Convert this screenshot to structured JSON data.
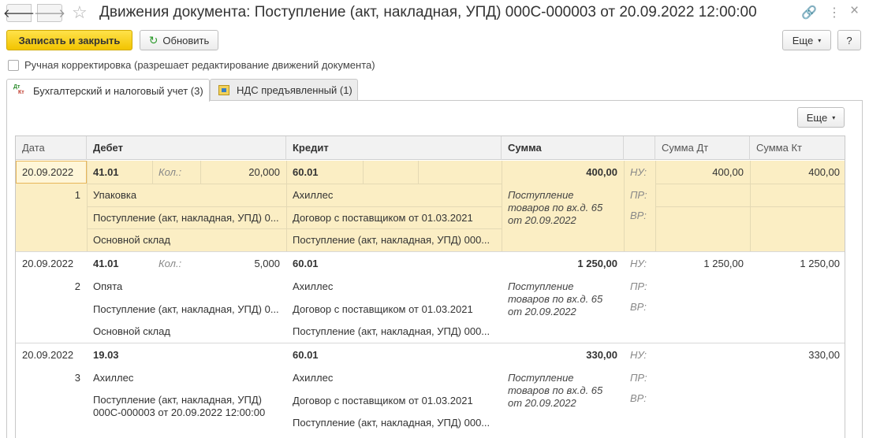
{
  "window": {
    "title": "Движения документа: Поступление (акт, накладная, УПД) 000С-000003 от 20.09.2022 12:00:00",
    "nav_back": "🡐",
    "nav_forward": "🡒",
    "star_icon": "☆",
    "link_icon": "🔗",
    "menu_icon": "⋮",
    "close_icon": "×"
  },
  "toolbar": {
    "save_close": "Записать и закрыть",
    "refresh_icon": "↻",
    "refresh": "Обновить",
    "more": "Еще",
    "more_caret": "▾",
    "help": "?"
  },
  "manual_correction": "Ручная корректировка (разрешает редактирование движений документа)",
  "tabs": [
    {
      "label": "Бухгалтерский и налоговый учет (3)",
      "icon_dt": "Дт",
      "icon_kt": "Кт"
    },
    {
      "label": "НДС предъявленный (1)"
    }
  ],
  "panel": {
    "more": "Еще",
    "more_caret": "▾"
  },
  "table": {
    "columns": {
      "date": "Дата",
      "debit": "Дебет",
      "credit": "Кредит",
      "sum": "Сумма",
      "sum_dt": "Сумма Дт",
      "sum_kt": "Сумма Кт"
    },
    "qty_label": "Кол.:",
    "nu_label": "НУ:",
    "pr_label": "ПР:",
    "vr_label": "ВР:",
    "rows": [
      {
        "date": "20.09.2022",
        "num": "1",
        "debit_account": "41.01",
        "debit_qty": "20,000",
        "debit_sub": [
          "Упаковка",
          "Поступление (акт, накладная, УПД) 0...",
          "Основной склад"
        ],
        "credit_account": "60.01",
        "credit_sub": [
          "Ахиллес",
          "Договор с поставщиком от 01.03.2021",
          "Поступление (акт, накладная, УПД) 000..."
        ],
        "sum": "400,00",
        "content": "Поступление товаров по вх.д. 65 от 20.09.2022",
        "sum_dt": "400,00",
        "sum_kt": "400,00"
      },
      {
        "date": "20.09.2022",
        "num": "2",
        "debit_account": "41.01",
        "debit_qty": "5,000",
        "debit_sub": [
          "Опята",
          "Поступление (акт, накладная, УПД) 0...",
          "Основной склад"
        ],
        "credit_account": "60.01",
        "credit_sub": [
          "Ахиллес",
          "Договор с поставщиком от 01.03.2021",
          "Поступление (акт, накладная, УПД) 000..."
        ],
        "sum": "1 250,00",
        "content": "Поступление товаров по вх.д. 65 от 20.09.2022",
        "sum_dt": "1 250,00",
        "sum_kt": "1 250,00"
      },
      {
        "date": "20.09.2022",
        "num": "3",
        "debit_account": "19.03",
        "debit_qty": "",
        "debit_sub": [
          "Ахиллес",
          "Поступление (акт, накладная, УПД) 000С-000003 от 20.09.2022 12:00:00",
          ""
        ],
        "credit_account": "60.01",
        "credit_sub": [
          "Ахиллес",
          "Договор с поставщиком от 01.03.2021",
          "Поступление (акт, накладная, УПД) 000..."
        ],
        "sum": "330,00",
        "content": "Поступление товаров по вх.д. 65 от 20.09.2022",
        "sum_dt": "",
        "sum_kt": "330,00"
      }
    ]
  }
}
